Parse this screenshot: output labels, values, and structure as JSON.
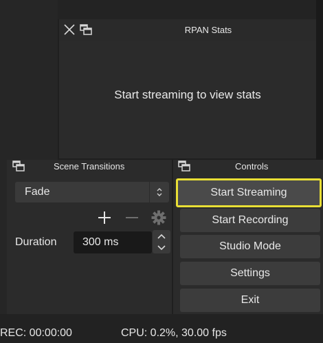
{
  "stats_dock": {
    "title": "RPAN Stats",
    "message": "Start streaming to view stats"
  },
  "scene_transitions": {
    "title": "Scene Transitions",
    "selected_transition": "Fade",
    "add_icon": "plus-icon",
    "remove_icon": "minus-icon",
    "config_icon": "gear-icon",
    "duration_label": "Duration",
    "duration_value": "300 ms"
  },
  "controls": {
    "title": "Controls",
    "start_streaming": "Start Streaming",
    "start_recording": "Start Recording",
    "studio_mode": "Studio Mode",
    "settings": "Settings",
    "exit": "Exit"
  },
  "status": {
    "rec": "REC: 00:00:00",
    "cpu": "CPU: 0.2%, 30.00 fps"
  },
  "colors": {
    "highlight": "#e9df35",
    "button": "#3c3c3c",
    "panel": "#2b2b2b"
  }
}
